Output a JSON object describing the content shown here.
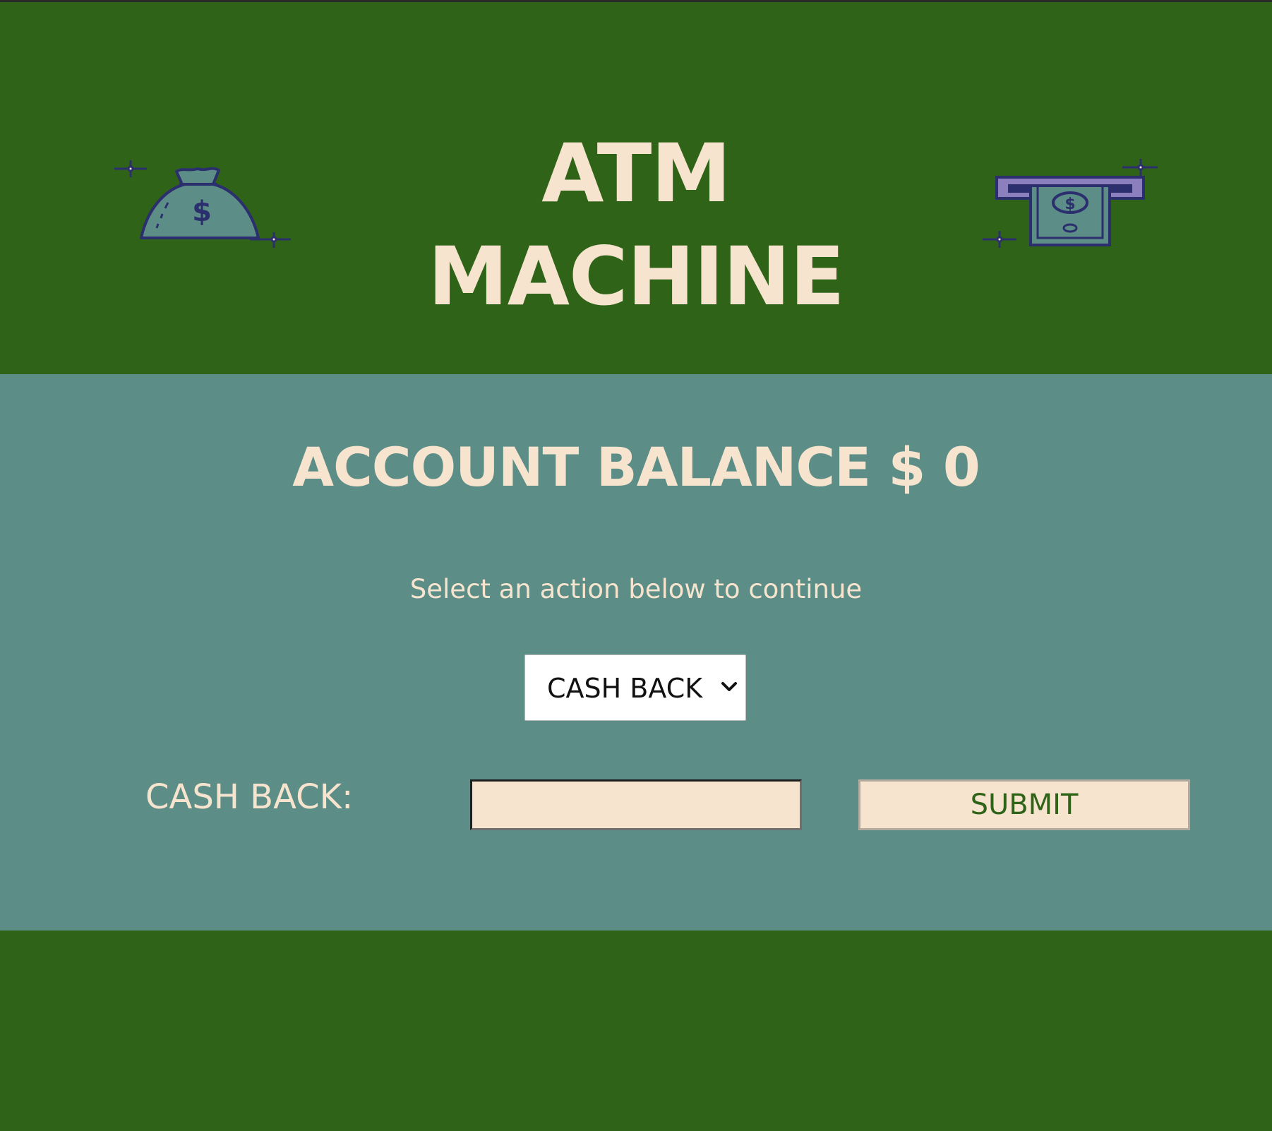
{
  "header": {
    "title_line1": "ATM",
    "title_line2": "MACHINE",
    "left_icon": "money-bag-icon",
    "right_icon": "atm-cash-icon"
  },
  "main": {
    "balance_text": "ACCOUNT BALANCE $ 0",
    "prompt": "Select an action below to continue",
    "action_select": {
      "selected": "CASH BACK"
    },
    "cash_back": {
      "label": "CASH BACK:",
      "value": "",
      "submit_label": "SUBMIT"
    }
  },
  "colors": {
    "header_bg": "#2f6418",
    "main_bg": "#5c8e87",
    "text_cream": "#f6e4cf",
    "button_text": "#2f6418"
  }
}
